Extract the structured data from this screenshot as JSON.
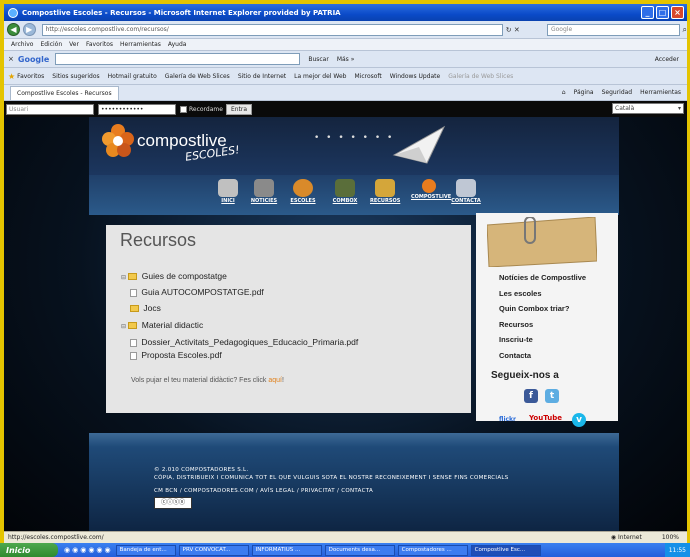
{
  "window": {
    "title": "Compostlive Escoles - Recursos - Microsoft Internet Explorer provided by PATRIA"
  },
  "browser": {
    "address": "http://escoles.compostlive.com/recursos/",
    "search_placeholder": "Google",
    "menu": [
      "Archivo",
      "Edición",
      "Ver",
      "Favoritos",
      "Herramientas",
      "Ayuda"
    ],
    "google_label": "Google",
    "google_buttons": [
      "Buscar",
      "Más »"
    ],
    "google_right": "Acceder",
    "favorites_label": "Favoritos",
    "favorites": [
      "Sitios sugeridos",
      "Hotmail gratuito",
      "Galería de Web Slices",
      "Sitio de Internet",
      "La mejor del Web",
      "Microsoft",
      "Windows Update",
      "Galería de Web Slices"
    ],
    "tab_label": "Compostlive Escoles - Recursos",
    "tools": [
      "Página",
      "Seguridad",
      "Herramientas"
    ]
  },
  "login": {
    "user_placeholder": "Usuari",
    "password_value": "••••••••••••",
    "remember_label": "Recordame",
    "enter_label": "Entra",
    "language": "Català"
  },
  "site": {
    "logo_text": "compostlive",
    "logo_sub": "ESCOLES!",
    "nav": [
      "INICI",
      "NOTICIES",
      "ESCOLES",
      "COMBOX",
      "RECURSOS",
      "COMPOSTLIVE",
      "CONTACTA"
    ]
  },
  "main": {
    "title": "Recursos",
    "tree": [
      {
        "type": "folder",
        "label": "Guies de compostatge"
      },
      {
        "type": "file",
        "label": "Guia AUTOCOMPOSTATGE.pdf"
      },
      {
        "type": "folder",
        "label": "Jocs"
      },
      {
        "type": "folder",
        "label": "Material didactic"
      },
      {
        "type": "file",
        "label": "Dossier_Activitats_Pedagogiques_Educacio_Primaria.pdf"
      },
      {
        "type": "file",
        "label": "Proposta Escoles.pdf"
      }
    ],
    "upload_prefix": "Vols pujar el teu material didàctic? Fes click ",
    "upload_link": "aquí",
    "upload_suffix": "!"
  },
  "sidebar": {
    "links": [
      "Notícies de Compostlive",
      "Les escoles",
      "Quin Combox triar?",
      "Recursos",
      "Inscriu-te",
      "Contacta"
    ],
    "follow_title": "Segueix-nos a",
    "social": [
      "f",
      "t",
      "flickr",
      "YouTube",
      "v"
    ]
  },
  "footer": {
    "line1": "© 2.010 COMPOSTADORES S.L.",
    "line2": "CÒPIA, DISTRIBUEIX I COMUNICA TOT EL QUE VULGUIS SOTA EL NOSTRE RECONEIXEMENT I SENSE FINS COMERCIALS",
    "line3": "CM BCN / COMPOSTADORES.COM / AVÍS LEGAL / PRIVACITAT / CONTACTA"
  },
  "status": {
    "url": "http://escoles.compostlive.com/",
    "zone": "Internet",
    "zoom": "100%"
  },
  "taskbar": {
    "start": "Inicio",
    "tasks": [
      "Bandeja de ent...",
      "PRV CONVOCAT...",
      "INFORMATIUS ...",
      "Documents desa...",
      "Compostadores ...",
      "Compostlive Esc..."
    ],
    "clock": "11:55"
  }
}
